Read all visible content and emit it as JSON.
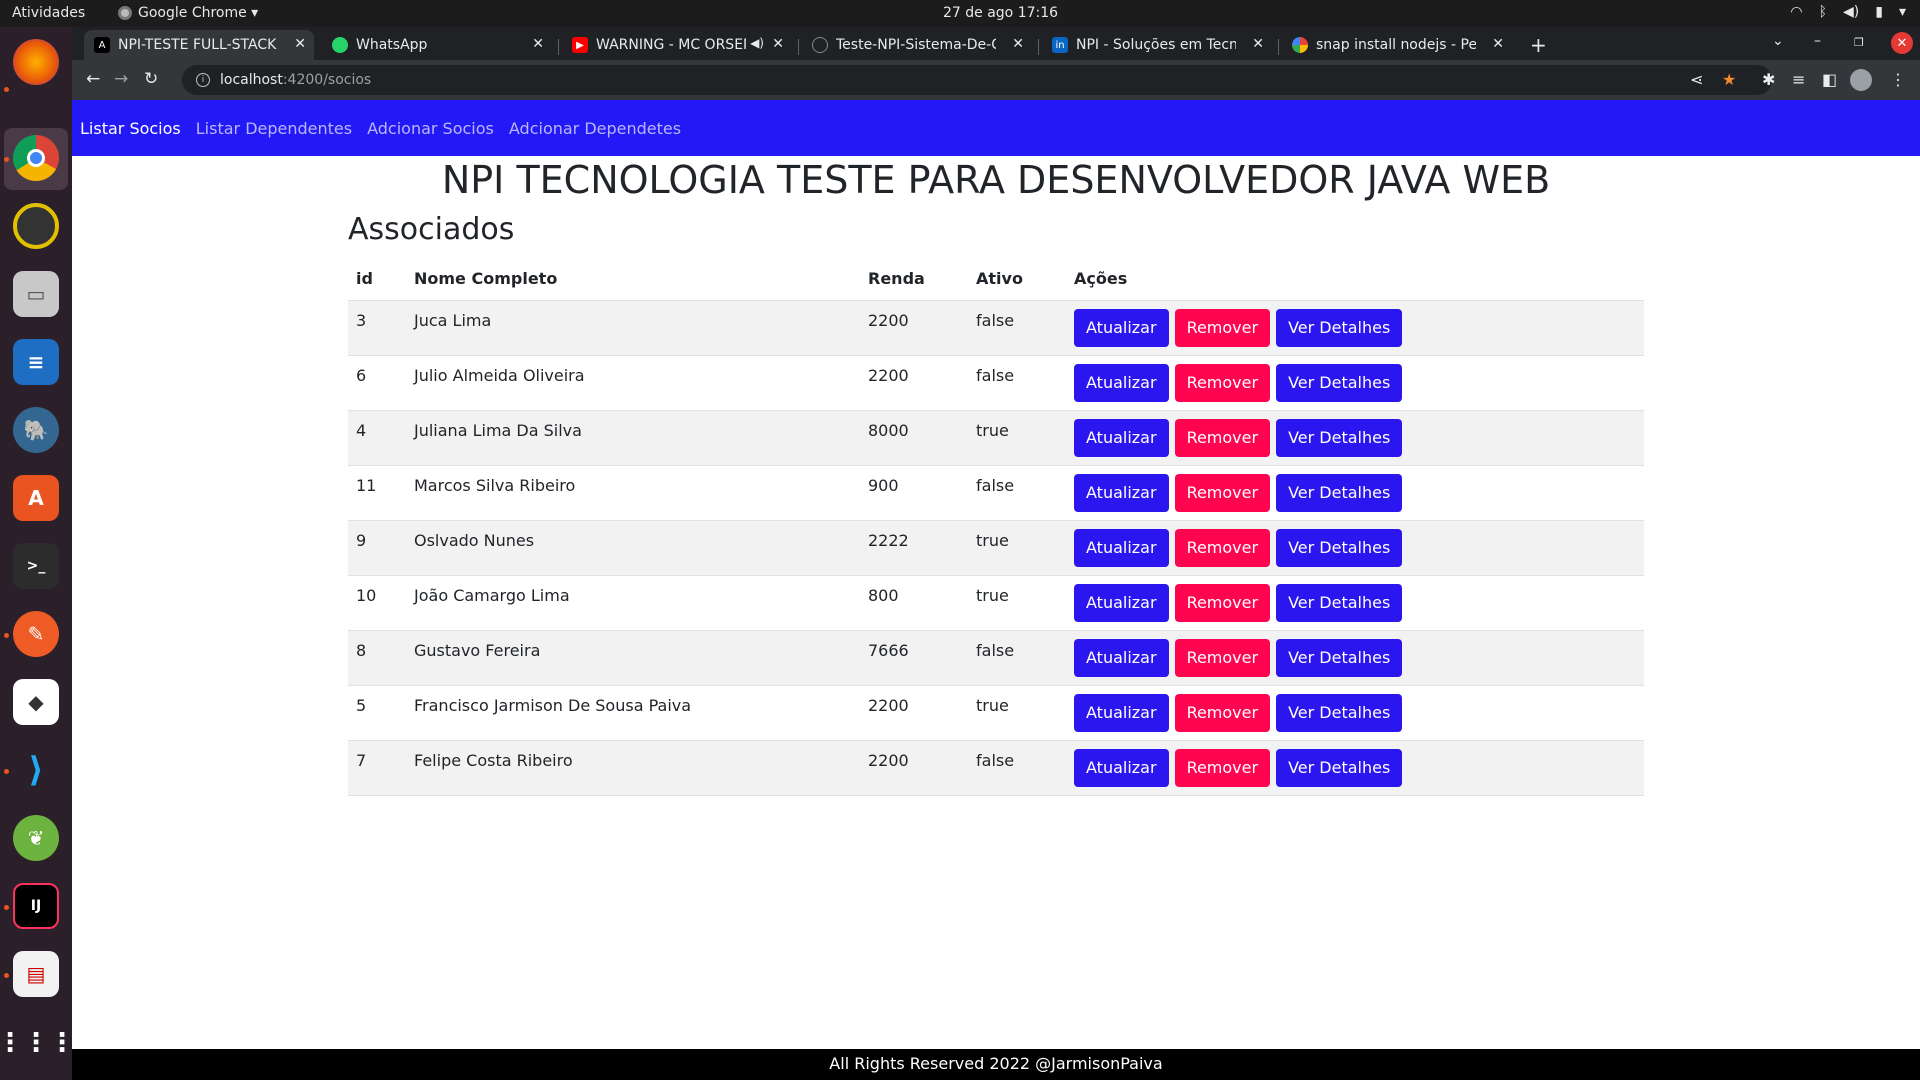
{
  "system": {
    "activities": "Atividades",
    "app_name": "Google Chrome ▾",
    "clock": "27 de ago  17:16"
  },
  "browser": {
    "tabs": [
      {
        "title": "NPI-TESTE FULL-STACK",
        "favicon": "angular-icon",
        "active": true
      },
      {
        "title": "WhatsApp",
        "favicon": "whatsapp-icon",
        "active": false
      },
      {
        "title": "WARNING - MC ORSEN",
        "favicon": "youtube-icon",
        "active": false
      },
      {
        "title": "Teste-NPI-Sistema-De-Cad",
        "favicon": "github-icon",
        "active": false
      },
      {
        "title": "NPI - Soluções em Tecnolo",
        "favicon": "linkedin-icon",
        "active": false
      },
      {
        "title": "snap install nodejs - Pesqu",
        "favicon": "google-icon",
        "active": false
      }
    ],
    "url_host": "localhost",
    "url_path": ":4200/socios"
  },
  "nav": {
    "items": [
      "Listar Socios",
      "Listar Dependentes",
      "Adcionar Socios",
      "Adcionar Dependetes"
    ]
  },
  "page": {
    "title": "NPI TECNOLOGIA TESTE PARA DESENVOLVEDOR JAVA WEB",
    "subtitle": "Associados",
    "footer": "All Rights Reserved 2022 @JarmisonPaiva"
  },
  "table": {
    "headers": [
      "id",
      "Nome Completo",
      "Renda",
      "Ativo",
      "Ações"
    ],
    "rows": [
      {
        "id": "3",
        "nome": "Juca Lima",
        "renda": "2200",
        "ativo": "false"
      },
      {
        "id": "6",
        "nome": "Julio Almeida Oliveira",
        "renda": "2200",
        "ativo": "false"
      },
      {
        "id": "4",
        "nome": "Juliana Lima Da Silva",
        "renda": "8000",
        "ativo": "true"
      },
      {
        "id": "11",
        "nome": "Marcos Silva Ribeiro",
        "renda": "900",
        "ativo": "false"
      },
      {
        "id": "9",
        "nome": "Oslvado Nunes",
        "renda": "2222",
        "ativo": "true"
      },
      {
        "id": "10",
        "nome": "João Camargo Lima",
        "renda": "800",
        "ativo": "true"
      },
      {
        "id": "8",
        "nome": "Gustavo Fereira",
        "renda": "7666",
        "ativo": "false"
      },
      {
        "id": "5",
        "nome": "Francisco Jarmison De Sousa Paiva",
        "renda": "2200",
        "ativo": "true"
      },
      {
        "id": "7",
        "nome": "Felipe Costa Ribeiro",
        "renda": "2200",
        "ativo": "false"
      }
    ],
    "actions": {
      "update": "Atualizar",
      "remove": "Remover",
      "details": "Ver Detalhes"
    }
  },
  "colors": {
    "navbar": "#2319f6",
    "button_blue": "#2b16f0",
    "button_red": "#ff0550"
  }
}
